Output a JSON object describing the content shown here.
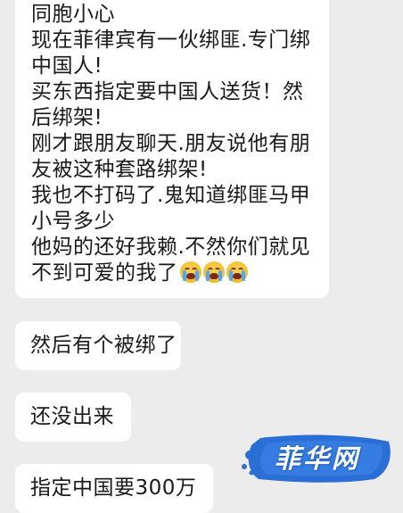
{
  "messages": [
    {
      "lines": [
        "同胞小心",
        "现在菲律宾有一伙绑匪.专门绑",
        "中国人!",
        "买东西指定要中国人送货！然",
        "后绑架!",
        "刚才跟朋友聊天.朋友说他有朋",
        "友被这种套路绑架!",
        "我也不打码了.鬼知道绑匪马甲",
        "小号多少",
        "他妈的还好我赖.不然你们就见",
        "不到可爱的我了"
      ],
      "trailing_emoji": [
        "crying-face-emoji",
        "crying-face-emoji",
        "crying-face-emoji"
      ]
    },
    {
      "text": "然后有个被绑了"
    },
    {
      "text": "还没出来"
    },
    {
      "text": "指定中国要300万"
    }
  ],
  "watermark": {
    "text": "菲华网",
    "colors": {
      "shape": "#2a6fd6",
      "text": "#ffffff"
    }
  },
  "colors": {
    "background": "#ececec",
    "bubble": "#ffffff",
    "text": "#1a1a1a"
  }
}
